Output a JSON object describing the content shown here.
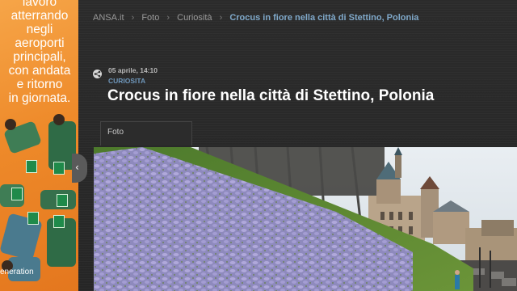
{
  "ad": {
    "lines": [
      "lavoro",
      "atterrando",
      "negli",
      "aeroporti",
      "principali,",
      "con andata",
      "e ritorno",
      "in giornata."
    ],
    "footer": "eneration"
  },
  "breadcrumb": {
    "site": "ANSA.it",
    "section": "Foto",
    "category": "Curiosità",
    "current": "Crocus in fiore nella città di Stettino, Polonia"
  },
  "article": {
    "date": "05 aprile, 14:10",
    "category": "CURIOSITA",
    "title": "Crocus in fiore nella città di Stettino, Polonia"
  },
  "tab": {
    "label": "Foto"
  },
  "photo": {
    "subject": "crocus field with castle"
  },
  "colors": {
    "accent": "#7fa8c9",
    "background": "#2a2a2a",
    "ad": "#ee8a2a"
  }
}
